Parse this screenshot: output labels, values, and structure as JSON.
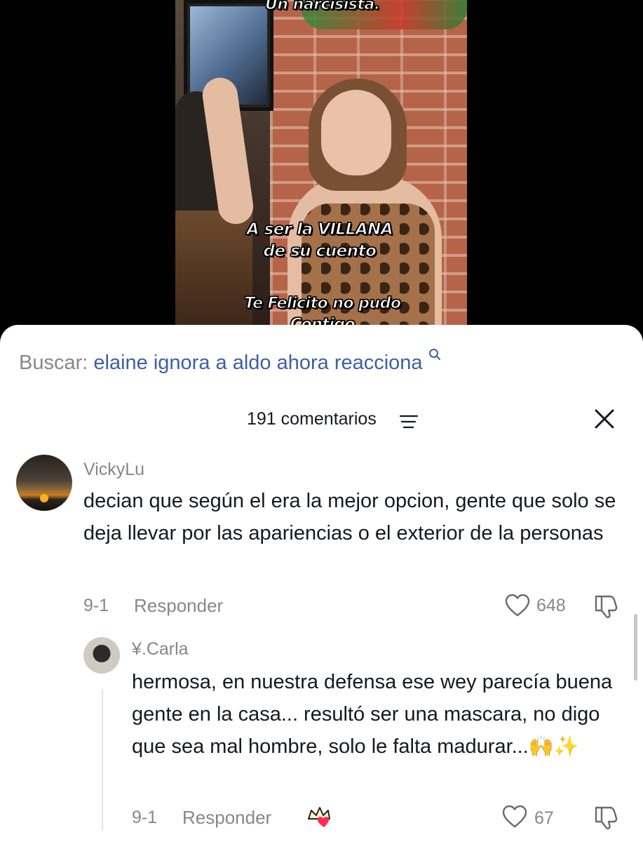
{
  "video": {
    "caption_top": "Un narcisista.",
    "caption_mid_line1": "A ser la VILLANA",
    "caption_mid_line2": "de su cuento",
    "caption_bottom_line1": "Te Felicito no pudo",
    "caption_bottom_line2": "Contigo"
  },
  "search": {
    "prefix": "Buscar:",
    "query": "elaine ignora a aldo ahora reacciona",
    "icon": "search-icon"
  },
  "header": {
    "count_label": "191 comentarios",
    "sort_icon": "sort-lines-icon",
    "close_icon": "close-icon"
  },
  "comments": [
    {
      "username": "VickyLu",
      "text": "decian que según el era la mejor opcion, gente que solo se deja llevar por las apariencias o el exterior de la personas",
      "date": "9-1",
      "reply_label": "Responder",
      "likes": "648",
      "avatar": "sunset-photo-avatar"
    },
    {
      "username": "¥.Carla",
      "text": "hermosa, en nuestra defensa ese wey parecía buena gente en la casa... resultó ser una mascara, no digo que sea mal hombre, solo le falta madurar...🙌✨",
      "date": "9-1",
      "reply_label": "Responder",
      "likes": "67",
      "avatar": "cat-photo-avatar",
      "creator_liked_icon": "crown-heart-icon"
    }
  ],
  "colors": {
    "link_blue": "#3e5ea8",
    "muted_gray": "#878787",
    "text_dark": "#161823"
  }
}
